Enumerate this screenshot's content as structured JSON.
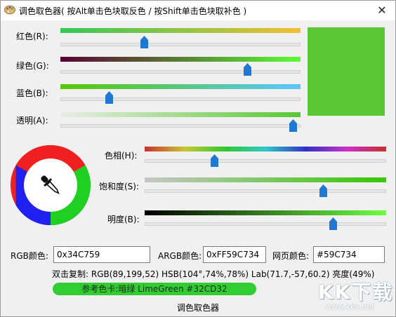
{
  "window": {
    "title": "调色取色器( 按Alt单击色块取反色 / 按Shift单击色块取补色 )",
    "close_glyph": "✕"
  },
  "colors": {
    "current": "#59C734",
    "red_bar_start": "#34C759",
    "red_bar_end": "#F0C030"
  },
  "channels": [
    {
      "label": "红色(R):",
      "value": 89,
      "max": 255
    },
    {
      "label": "绿色(G):",
      "value": 199,
      "max": 255
    },
    {
      "label": "蓝色(B):",
      "value": 52,
      "max": 255
    },
    {
      "label": "透明(A):",
      "value": 247,
      "max": 255
    }
  ],
  "hsb": [
    {
      "label": "色相(H):",
      "value": 104,
      "max": 360
    },
    {
      "label": "饱和度(S):",
      "value": 74,
      "max": 100
    },
    {
      "label": "明度(B):",
      "value": 78,
      "max": 100
    }
  ],
  "fields": {
    "rgb": {
      "label": "RGB颜色:",
      "value": "0x34C759"
    },
    "argb": {
      "label": "ARGB颜色:",
      "value": "0xFF59C734"
    },
    "web": {
      "label": "网页颜色:",
      "value": "#59C734"
    }
  },
  "info_line": "双击复制: RGB(89,199,52) HSB(104°,74%,78%) Lab(71.7,-57,60.2) 亮度(49%)",
  "reference": {
    "text": "参考色卡:暗绿 LimeGreen #32CD32",
    "color": "#32CD32"
  },
  "status_text": "调色取色器",
  "icons": {
    "app": "palette-icon",
    "dropper": "eyedropper-icon",
    "close": "close-icon"
  },
  "watermark": {
    "logo": "KK下载",
    "url": "www.kkx.net"
  }
}
